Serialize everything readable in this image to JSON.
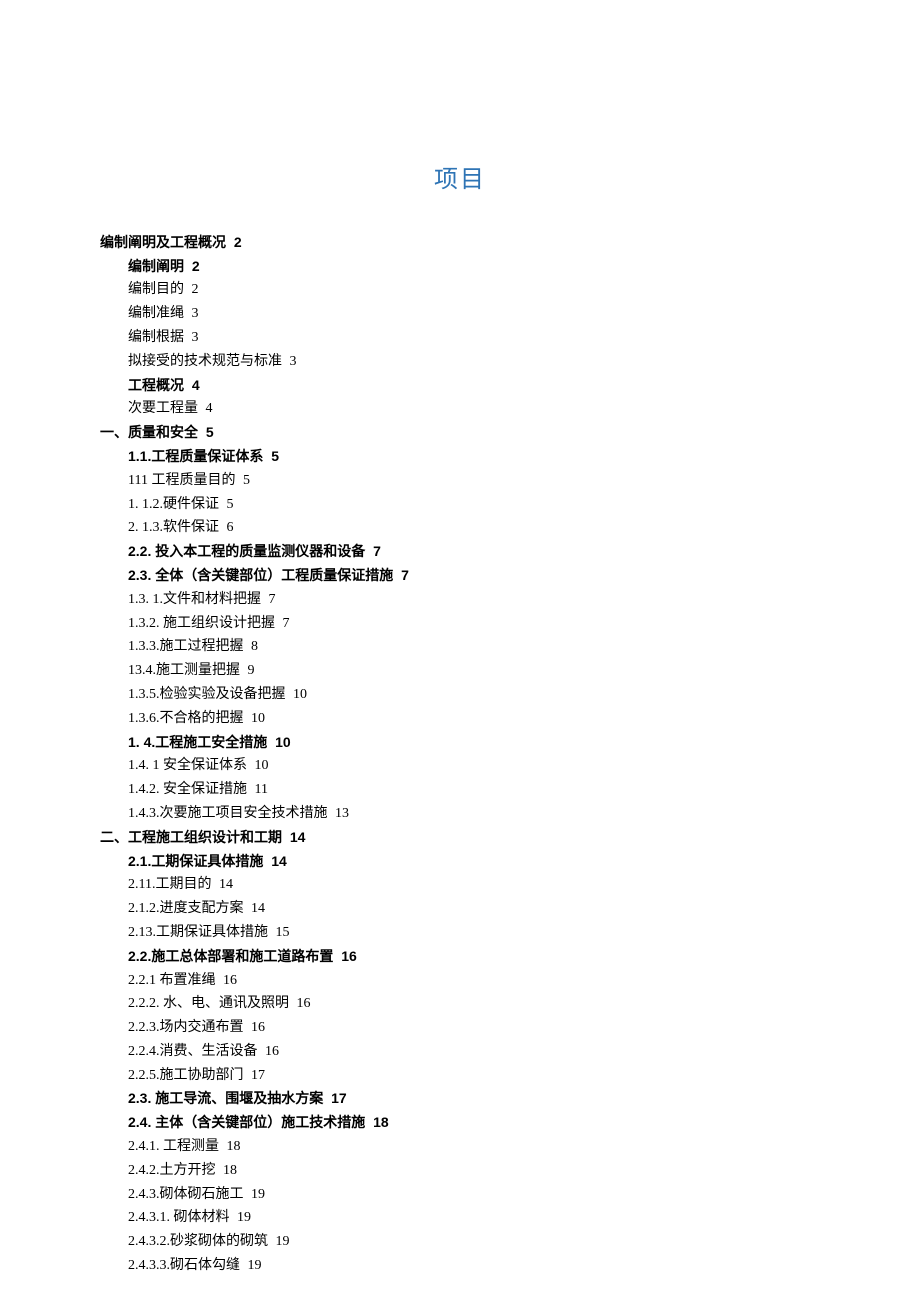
{
  "title": "项目",
  "toc": [
    {
      "level": 1,
      "bold": true,
      "text": "编制阐明及工程概况",
      "page": "2"
    },
    {
      "level": 2,
      "bold": true,
      "text": "编制阐明",
      "page": "2"
    },
    {
      "level": 2,
      "bold": false,
      "text": "编制目的",
      "page": "2"
    },
    {
      "level": 2,
      "bold": false,
      "text": "编制准绳",
      "page": "3"
    },
    {
      "level": 2,
      "bold": false,
      "text": "编制根据",
      "page": "3"
    },
    {
      "level": 2,
      "bold": false,
      "text": "拟接受的技术规范与标准",
      "page": "3"
    },
    {
      "level": 2,
      "bold": true,
      "text": "工程概况",
      "page": "4"
    },
    {
      "level": 2,
      "bold": false,
      "text": "次要工程量",
      "page": "4"
    },
    {
      "level": 1,
      "bold": true,
      "text": "一、质量和安全",
      "page": "5"
    },
    {
      "level": 2,
      "bold": true,
      "text": "1.1.工程质量保证体系",
      "page": "5"
    },
    {
      "level": 2,
      "bold": false,
      "text": "111 工程质量目的",
      "page": "5"
    },
    {
      "level": 2,
      "bold": false,
      "text": "1.   1.2.硬件保证",
      "page": "5"
    },
    {
      "level": 2,
      "bold": false,
      "text": "2.   1.3.软件保证",
      "page": "6"
    },
    {
      "level": 2,
      "bold": true,
      "text": "2.2.   投入本工程的质量监测仪器和设备",
      "page": "7"
    },
    {
      "level": 2,
      "bold": true,
      "text": "2.3.   全体（含关键部位）工程质量保证措施",
      "page": "7"
    },
    {
      "level": 2,
      "bold": false,
      "text": "1.3.    1.文件和材料把握",
      "page": "7"
    },
    {
      "level": 2,
      "bold": false,
      "text": "1.3.2.     施工组织设计把握",
      "page": "7"
    },
    {
      "level": 2,
      "bold": false,
      "text": "1.3.3.施工过程把握",
      "page": "8"
    },
    {
      "level": 2,
      "bold": false,
      "text": "13.4.施工测量把握",
      "page": "9"
    },
    {
      "level": 2,
      "bold": false,
      "text": "1.3.5.检验实验及设备把握",
      "page": "10"
    },
    {
      "level": 2,
      "bold": false,
      "text": "1.3.6.不合格的把握",
      "page": "10"
    },
    {
      "level": 2,
      "bold": true,
      "text": "1.  4.工程施工安全措施",
      "page": "10"
    },
    {
      "level": 2,
      "bold": false,
      "text": "1.4.    1 安全保证体系",
      "page": "10"
    },
    {
      "level": 2,
      "bold": false,
      "text": "1.4.2.     安全保证措施",
      "page": "11"
    },
    {
      "level": 2,
      "bold": false,
      "text": "1.4.3.次要施工项目安全技术措施",
      "page": "13"
    },
    {
      "level": 1,
      "bold": true,
      "text": "二、工程施工组织设计和工期",
      "page": "14"
    },
    {
      "level": 2,
      "bold": true,
      "text": "2.1.工期保证具体措施",
      "page": "14"
    },
    {
      "level": 2,
      "bold": false,
      "text": "2.11.工期目的",
      "page": "14"
    },
    {
      "level": 2,
      "bold": false,
      "text": "2.1.2.进度支配方案",
      "page": "14"
    },
    {
      "level": 2,
      "bold": false,
      "text": "2.13.工期保证具体措施",
      "page": "15"
    },
    {
      "level": 2,
      "bold": true,
      "text": "2.2.施工总体部署和施工道路布置",
      "page": "16"
    },
    {
      "level": 2,
      "bold": false,
      "text": "2.2.1 布置准绳",
      "page": "16"
    },
    {
      "level": 2,
      "bold": false,
      "text": "2.2.2. 水、电、通讯及照明",
      "page": "16"
    },
    {
      "level": 2,
      "bold": false,
      "text": "2.2.3.场内交通布置",
      "page": "16"
    },
    {
      "level": 2,
      "bold": false,
      "text": "2.2.4.消费、生活设备",
      "page": "16"
    },
    {
      "level": 2,
      "bold": false,
      "text": "2.2.5.施工协助部门",
      "page": "17"
    },
    {
      "level": 2,
      "bold": true,
      "text": "2.3. 施工导流、围堰及抽水方案",
      "page": "17"
    },
    {
      "level": 2,
      "bold": true,
      "text": "2.4. 主体（含关键部位）施工技术措施",
      "page": "18"
    },
    {
      "level": 2,
      "bold": false,
      "text": "2.4.1. 工程测量",
      "page": "18"
    },
    {
      "level": 2,
      "bold": false,
      "text": "2.4.2.土方开挖",
      "page": "18"
    },
    {
      "level": 2,
      "bold": false,
      "text": "2.4.3.砌体砌石施工",
      "page": "19"
    },
    {
      "level": 2,
      "bold": false,
      "text": "2.4.3.1. 砌体材料",
      "page": "19"
    },
    {
      "level": 2,
      "bold": false,
      "text": "2.4.3.2.砂浆砌体的砌筑",
      "page": "19"
    },
    {
      "level": 2,
      "bold": false,
      "text": "2.4.3.3.砌石体勾缝",
      "page": "19"
    }
  ]
}
